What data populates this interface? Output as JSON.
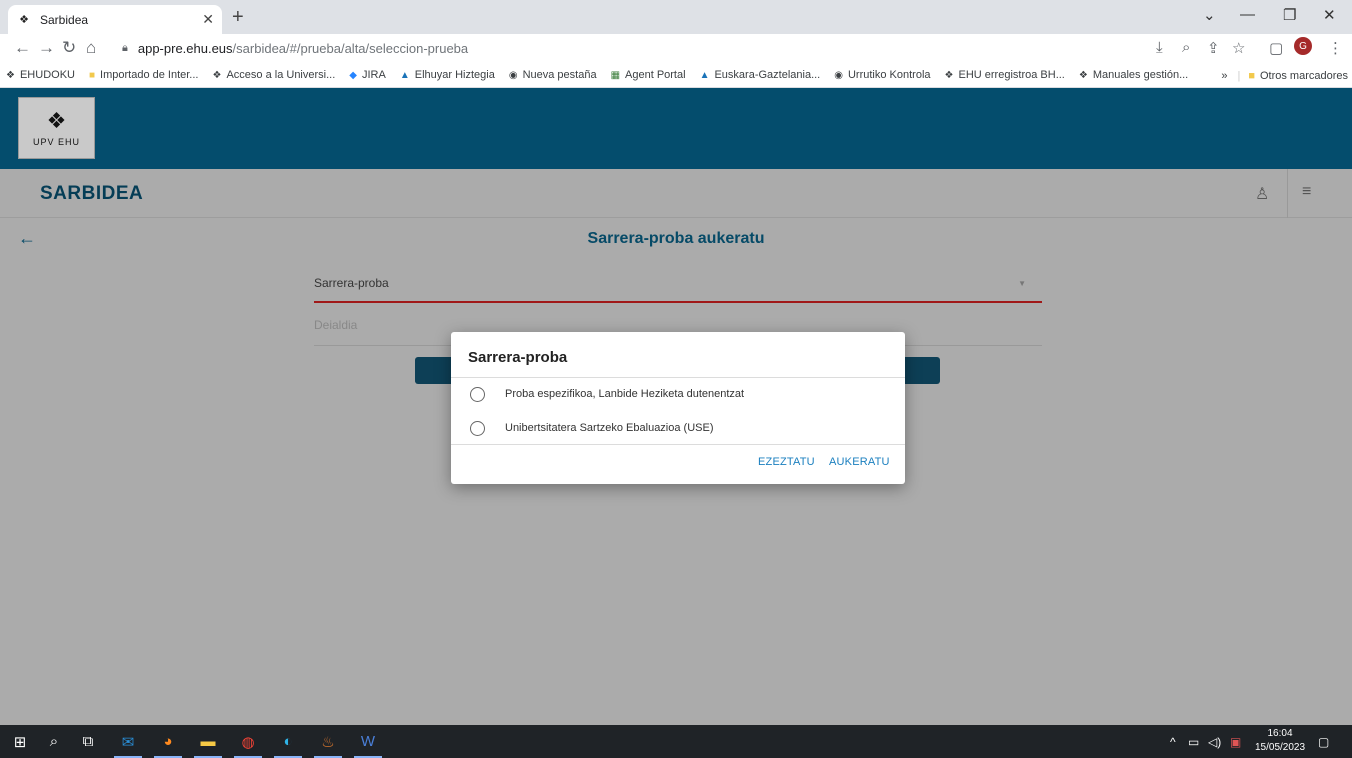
{
  "browser": {
    "tab_title": "Sarbidea",
    "tab_favicon": "upv-ehu-icon",
    "url_host": "app-pre.ehu.eus",
    "url_path": "/sarbidea/#/prueba/alta/seleccion-prueba",
    "profile_initial": "G",
    "bookmarks": [
      {
        "label": "EHUDOKU",
        "icon": "ehu-icon"
      },
      {
        "label": "Importado de Inter...",
        "icon": "folder-icon"
      },
      {
        "label": "Acceso a la Universi...",
        "icon": "ehu-icon"
      },
      {
        "label": "JIRA",
        "icon": "jira-icon"
      },
      {
        "label": "Elhuyar Hiztegia",
        "icon": "elhuyar-icon"
      },
      {
        "label": "Nueva pestaña",
        "icon": "globe-icon"
      },
      {
        "label": "Agent Portal",
        "icon": "agent-icon"
      },
      {
        "label": "Euskara-Gaztelania...",
        "icon": "elhuyar-icon"
      },
      {
        "label": "Urrutiko Kontrola",
        "icon": "globe-icon"
      },
      {
        "label": "EHU erregistroa BH...",
        "icon": "ehu-icon"
      },
      {
        "label": "Manuales gestión...",
        "icon": "ehu-icon"
      }
    ],
    "bookmarks_more": "»",
    "other_bookmarks": "Otros marcadores"
  },
  "app": {
    "logo_text": "UPV  EHU",
    "title": "SARBIDEA",
    "page_title": "Sarrera-proba aukeratu",
    "field_test_label": "Sarrera-proba",
    "field_call_label": "Deialdia"
  },
  "dialog": {
    "title": "Sarrera-proba",
    "options": [
      "Proba espezifikoa, Lanbide Heziketa dutenentzat",
      "Unibertsitatera Sartzeko Ebaluazioa (USE)"
    ],
    "cancel_label": "EZEZTATU",
    "confirm_label": "AUKERATU"
  },
  "taskbar": {
    "time": "16:04",
    "date": "15/05/2023"
  },
  "colors": {
    "header": "#044d6d",
    "accent": "#1a7fbf",
    "field_underline": "#a01818"
  }
}
